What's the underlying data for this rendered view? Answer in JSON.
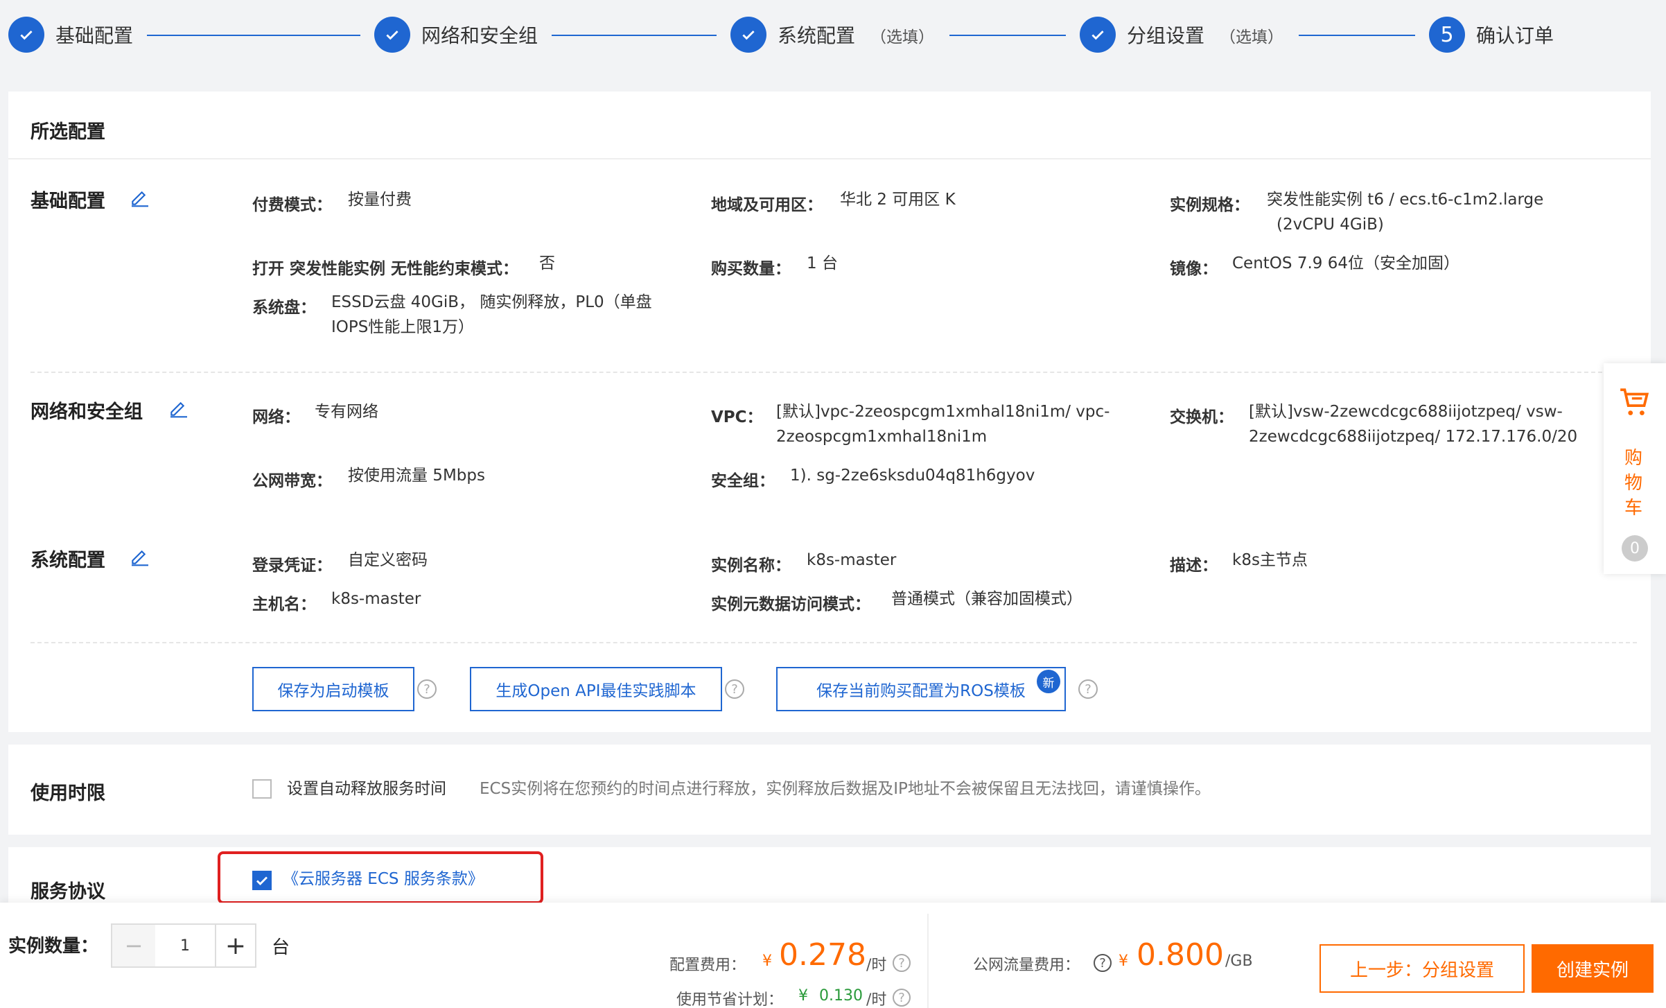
{
  "steps": [
    {
      "label": "基础配置",
      "optional": ""
    },
    {
      "label": "网络和安全组",
      "optional": ""
    },
    {
      "label": "系统配置",
      "optional": "（选填）"
    },
    {
      "label": "分组设置",
      "optional": "（选填）"
    },
    {
      "number": "5",
      "label": "确认订单"
    }
  ],
  "selected": {
    "title": "所选配置",
    "basic": {
      "title": "基础配置",
      "billing_label": "付费模式：",
      "billing_value": "按量付费",
      "region_label": "地域及可用区：",
      "region_value": "华北 2 可用区 K",
      "spec_label": "实例规格：",
      "spec_value_1": "突发性能实例 t6 / ecs.t6-c1m2.large",
      "spec_value_2": "(2vCPU 4GiB)",
      "burst_label": "打开 突发性能实例 无性能约束模式：",
      "burst_value": "否",
      "qty_label": "购买数量：",
      "qty_value": "1 台",
      "image_label": "镜像：",
      "image_value": "CentOS 7.9 64位（安全加固）",
      "disk_label": "系统盘：",
      "disk_value_1": "ESSD云盘 40GiB， 随实例释放，PL0（单盘",
      "disk_value_2": "IOPS性能上限1万）"
    },
    "network": {
      "title": "网络和安全组",
      "net_label": "网络：",
      "net_value": "专有网络",
      "vpc_label": "VPC：",
      "vpc_value_1": "[默认]vpc-2zeospcgm1xmhal18ni1m/ vpc-",
      "vpc_value_2": "2zeospcgm1xmhal18ni1m",
      "switch_label": "交换机：",
      "switch_value_1": "[默认]vsw-2zewcdcgc688iijotzpeq/ vsw-",
      "switch_value_2": "2zewcdcgc688iijotzpeq/ 172.17.176.0/20",
      "bw_label": "公网带宽：",
      "bw_value": "按使用流量 5Mbps",
      "sg_label": "安全组：",
      "sg_value": "1). sg-2ze6sksdu04q81h6gyov"
    },
    "system": {
      "title": "系统配置",
      "login_label": "登录凭证：",
      "login_value": "自定义密码",
      "name_label": "实例名称：",
      "name_value": "k8s-master",
      "desc_label": "描述：",
      "desc_value": "k8s主节点",
      "host_label": "主机名：",
      "host_value": "k8s-master",
      "meta_label": "实例元数据访问模式：",
      "meta_value": "普通模式（兼容加固模式）"
    },
    "buttons": {
      "save_template": "保存为启动模板",
      "gen_api": "生成Open API最佳实践脚本",
      "save_ros": "保存当前购买配置为ROS模板",
      "new_badge": "新"
    }
  },
  "usage": {
    "title": "使用时限",
    "auto_release_label": "设置自动释放服务时间",
    "auto_release_desc": "ECS实例将在您预约的时间点进行释放，实例释放后数据及IP地址不会被保留且无法找回，请谨慎操作。"
  },
  "agreement": {
    "title": "服务协议",
    "link": "《云服务器 ECS 服务条款》"
  },
  "cart": {
    "chars": [
      "购",
      "物",
      "车"
    ],
    "count": "0"
  },
  "bottom": {
    "qty_label": "实例数量：",
    "qty_value": "1",
    "qty_unit": "台",
    "config_fee_label": "配置费用：",
    "config_fee_currency": "¥",
    "config_fee_value": "0.278",
    "config_fee_unit": "/时",
    "saving_label": "使用节省计划：",
    "saving_currency": "¥",
    "saving_value": "0.130",
    "saving_unit": "/时",
    "traffic_label": "公网流量费用：",
    "traffic_currency": "¥",
    "traffic_value": "0.800",
    "traffic_unit": "/GB",
    "prev_button": "上一步：分组设置",
    "create_button": "创建实例"
  },
  "colors": {
    "accent": "#1f66d1",
    "orange": "#ff6a00",
    "highlight": "#e02020"
  }
}
